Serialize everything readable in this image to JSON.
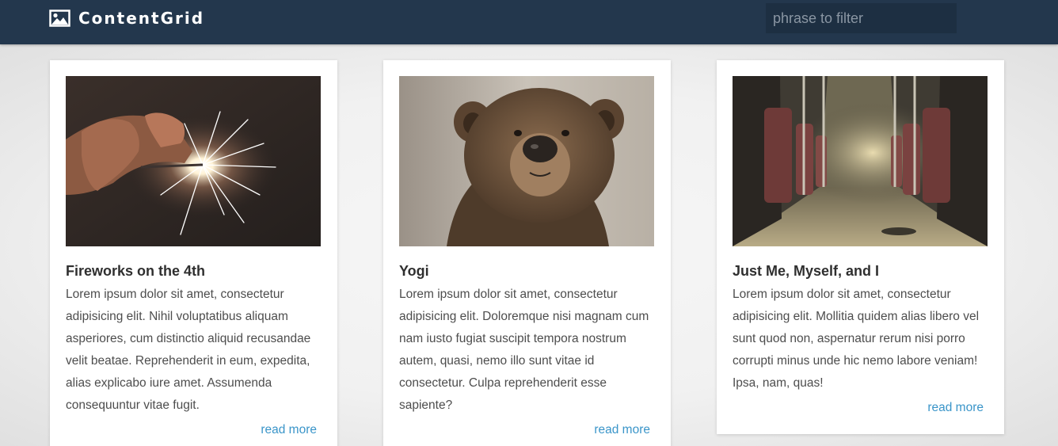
{
  "navbar": {
    "brand": "ContentGrid",
    "search_placeholder": "phrase to filter"
  },
  "cards": [
    {
      "title": "Fireworks on the 4th",
      "text": "Lorem ipsum dolor sit amet, consectetur adipisicing elit. Nihil voluptatibus aliquam asperiores, cum distinctio aliquid recusandae velit beatae. Reprehenderit in eum, expedita, alias explicabo iure amet. Assumenda consequuntur vitae fugit.",
      "link": "read more"
    },
    {
      "title": "Yogi",
      "text": "Lorem ipsum dolor sit amet, consectetur adipisicing elit. Doloremque nisi magnam cum nam iusto fugiat suscipit tempora nostrum autem, quasi, nemo illo sunt vitae id consectetur. Culpa reprehenderit esse sapiente?",
      "link": "read more"
    },
    {
      "title": "Just Me, Myself, and I",
      "text": "Lorem ipsum dolor sit amet, consectetur adipisicing elit. Mollitia quidem alias libero vel sunt quod non, aspernatur rerum nisi porro corrupti minus unde hic nemo labore veniam! Ipsa, nam, quas!",
      "link": "read more"
    }
  ],
  "colors": {
    "navbar": "#23374d",
    "search_bg": "#1d2f42",
    "link": "#3a95c9",
    "title": "#2f2f2f",
    "text": "#4d4d4d"
  },
  "icons": {
    "brand": "image-icon"
  }
}
